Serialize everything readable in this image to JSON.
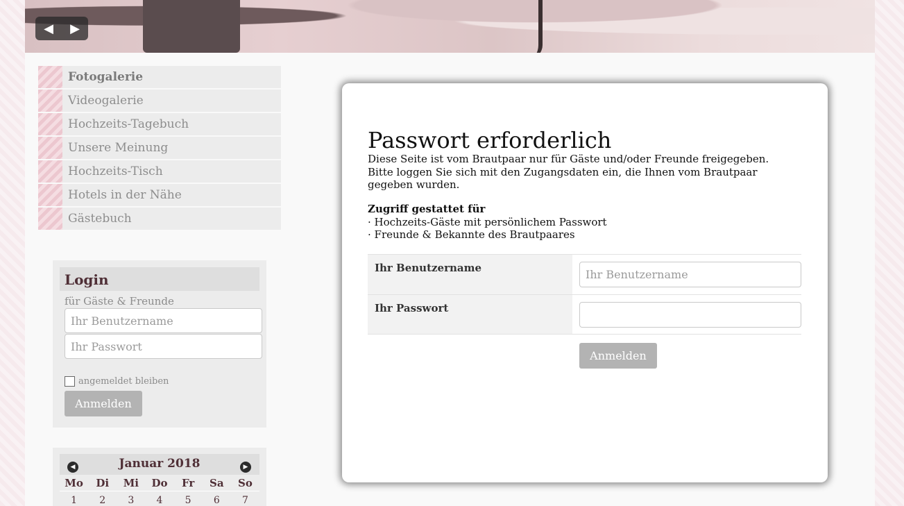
{
  "slider": {
    "prev_icon": "◀",
    "next_icon": "▶"
  },
  "nav": {
    "items": [
      {
        "label": "Fotogalerie",
        "active": true
      },
      {
        "label": "Videogalerie"
      },
      {
        "label": "Hochzeits-Tagebuch"
      },
      {
        "label": "Unsere Meinung"
      },
      {
        "label": "Hochzeits-Tisch"
      },
      {
        "label": "Hotels in der Nähe"
      },
      {
        "label": "Gästebuch"
      }
    ]
  },
  "sidebar_login": {
    "title": "Login",
    "subtitle": "für Gäste & Freunde",
    "username_placeholder": "Ihr Benutzername",
    "password_placeholder": "Ihr Passwort",
    "remember_label": "angemeldet bleiben",
    "submit_label": "Anmelden"
  },
  "calendar": {
    "title": "Januar 2018",
    "prev_icon": "◀",
    "next_icon": "▶",
    "weekdays": [
      "Mo",
      "Di",
      "Mi",
      "Do",
      "Fr",
      "Sa",
      "So"
    ],
    "dates": [
      "1",
      "2",
      "3",
      "4",
      "5",
      "6",
      "7"
    ]
  },
  "main": {
    "title": "Passwort erforderlich",
    "intro": "Diese Seite ist vom Brautpaar nur für Gäste und/oder Freunde freigegeben. Bitte loggen Sie sich mit den Zugangsdaten ein, die Ihnen vom Brautpaar gegeben wurden.",
    "access_title": "Zugriff gestattet für",
    "access_items": [
      "· Hochzeits-Gäste mit persönlichem Passwort",
      "· Freunde & Bekannte des Brautpaares"
    ],
    "form": {
      "username_label": "Ihr Benutzername",
      "username_placeholder": "Ihr Benutzername",
      "password_label": "Ihr Passwort",
      "password_placeholder": "",
      "submit_label": "Anmelden"
    }
  }
}
